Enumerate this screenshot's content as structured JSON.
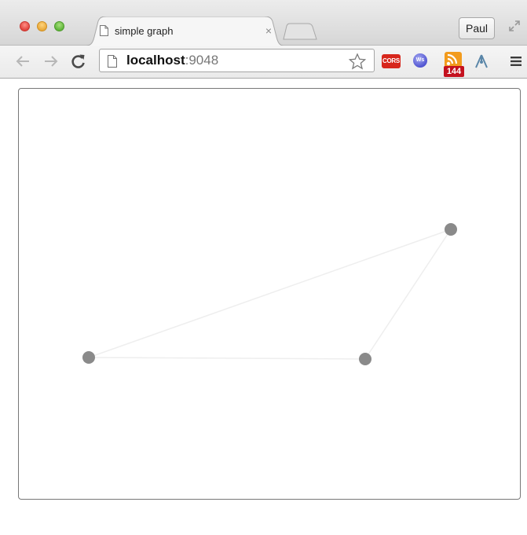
{
  "browser": {
    "tab_title": "simple graph",
    "tab_close": "×",
    "profile_name": "Paul",
    "url_host": "localhost",
    "url_port": ":9048",
    "extensions": {
      "cors_label": "CORS",
      "ws_label": "Ws",
      "rss_count": "144"
    }
  },
  "graph": {
    "node_color": "#8a8a8a",
    "link_color": "#eeeeee",
    "nodes": [
      {
        "id": "a"
      },
      {
        "id": "b"
      },
      {
        "id": "c"
      }
    ],
    "links": [
      {
        "source": "a",
        "target": "c"
      },
      {
        "source": "c",
        "target": "b"
      },
      {
        "source": "b",
        "target": "a"
      }
    ]
  }
}
